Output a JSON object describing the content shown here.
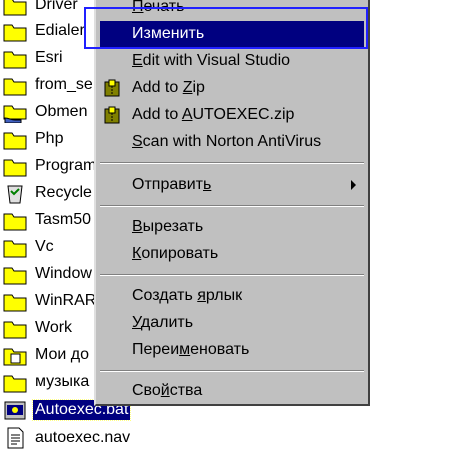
{
  "explorer": {
    "items": [
      {
        "label": "Driver",
        "icon": "folder-icon"
      },
      {
        "label": "Edialer",
        "icon": "folder-icon"
      },
      {
        "label": "Esri",
        "icon": "folder-icon"
      },
      {
        "label": "from_se",
        "icon": "folder-icon"
      },
      {
        "label": "Obmen",
        "icon": "shared-folder-icon"
      },
      {
        "label": "Php",
        "icon": "folder-icon"
      },
      {
        "label": "Program",
        "icon": "folder-icon"
      },
      {
        "label": "Recycle",
        "icon": "recycle-bin-icon"
      },
      {
        "label": "Tasm50",
        "icon": "folder-icon"
      },
      {
        "label": "Vc",
        "icon": "folder-icon"
      },
      {
        "label": "Window",
        "icon": "folder-icon"
      },
      {
        "label": "WinRAR",
        "icon": "folder-icon"
      },
      {
        "label": "Work",
        "icon": "folder-icon"
      },
      {
        "label": "Мои до",
        "icon": "my-documents-icon"
      },
      {
        "label": "музыка",
        "icon": "folder-icon"
      },
      {
        "label": "Autoexec.bat",
        "icon": "batch-file-icon",
        "selected": true
      },
      {
        "label": "autoexec.nav",
        "icon": "text-file-icon"
      }
    ]
  },
  "context_menu": {
    "items": [
      {
        "label": "Печать",
        "accel": "П",
        "rest": "ечать"
      },
      {
        "label": "Изменить",
        "accel": "",
        "rest": "Изменить",
        "highlighted": true
      },
      {
        "label": "Edit with Visual Studio",
        "accel": "E",
        "rest": "dit with Visual Studio"
      },
      {
        "label": "Add to Zip",
        "pre": "Add to ",
        "accel": "Z",
        "rest": "ip",
        "icon": "winzip-icon"
      },
      {
        "label": "Add to AUTOEXEC.zip",
        "pre": "Add to ",
        "accel": "A",
        "rest": "UTOEXEC.zip",
        "icon": "winzip-icon"
      },
      {
        "label": "Scan with Norton AntiVirus",
        "accel": "S",
        "rest": "can with Norton AntiVirus"
      },
      {
        "label": "Отправить",
        "pre": "Отправит",
        "accel": "ь",
        "rest": "",
        "submenu": true
      },
      {
        "label": "Вырезать",
        "pre": "",
        "accel": "В",
        "rest": "ырезать"
      },
      {
        "label": "Копировать",
        "accel": "К",
        "rest": "опировать"
      },
      {
        "label": "Создать ярлык",
        "pre": "Создать ",
        "accel": "я",
        "rest": "рлык"
      },
      {
        "label": "Удалить",
        "accel": "У",
        "rest": "далить"
      },
      {
        "label": "Переименовать",
        "pre": "Переи",
        "accel": "м",
        "rest": "еновать"
      },
      {
        "label": "Свойства",
        "pre": "Сво",
        "accel": "й",
        "rest": "ства"
      }
    ]
  },
  "colors": {
    "menu_bg": "#c0c0c0",
    "highlight": "#000080",
    "focus_outline": "#2020ff",
    "folder": "#ffff00"
  }
}
